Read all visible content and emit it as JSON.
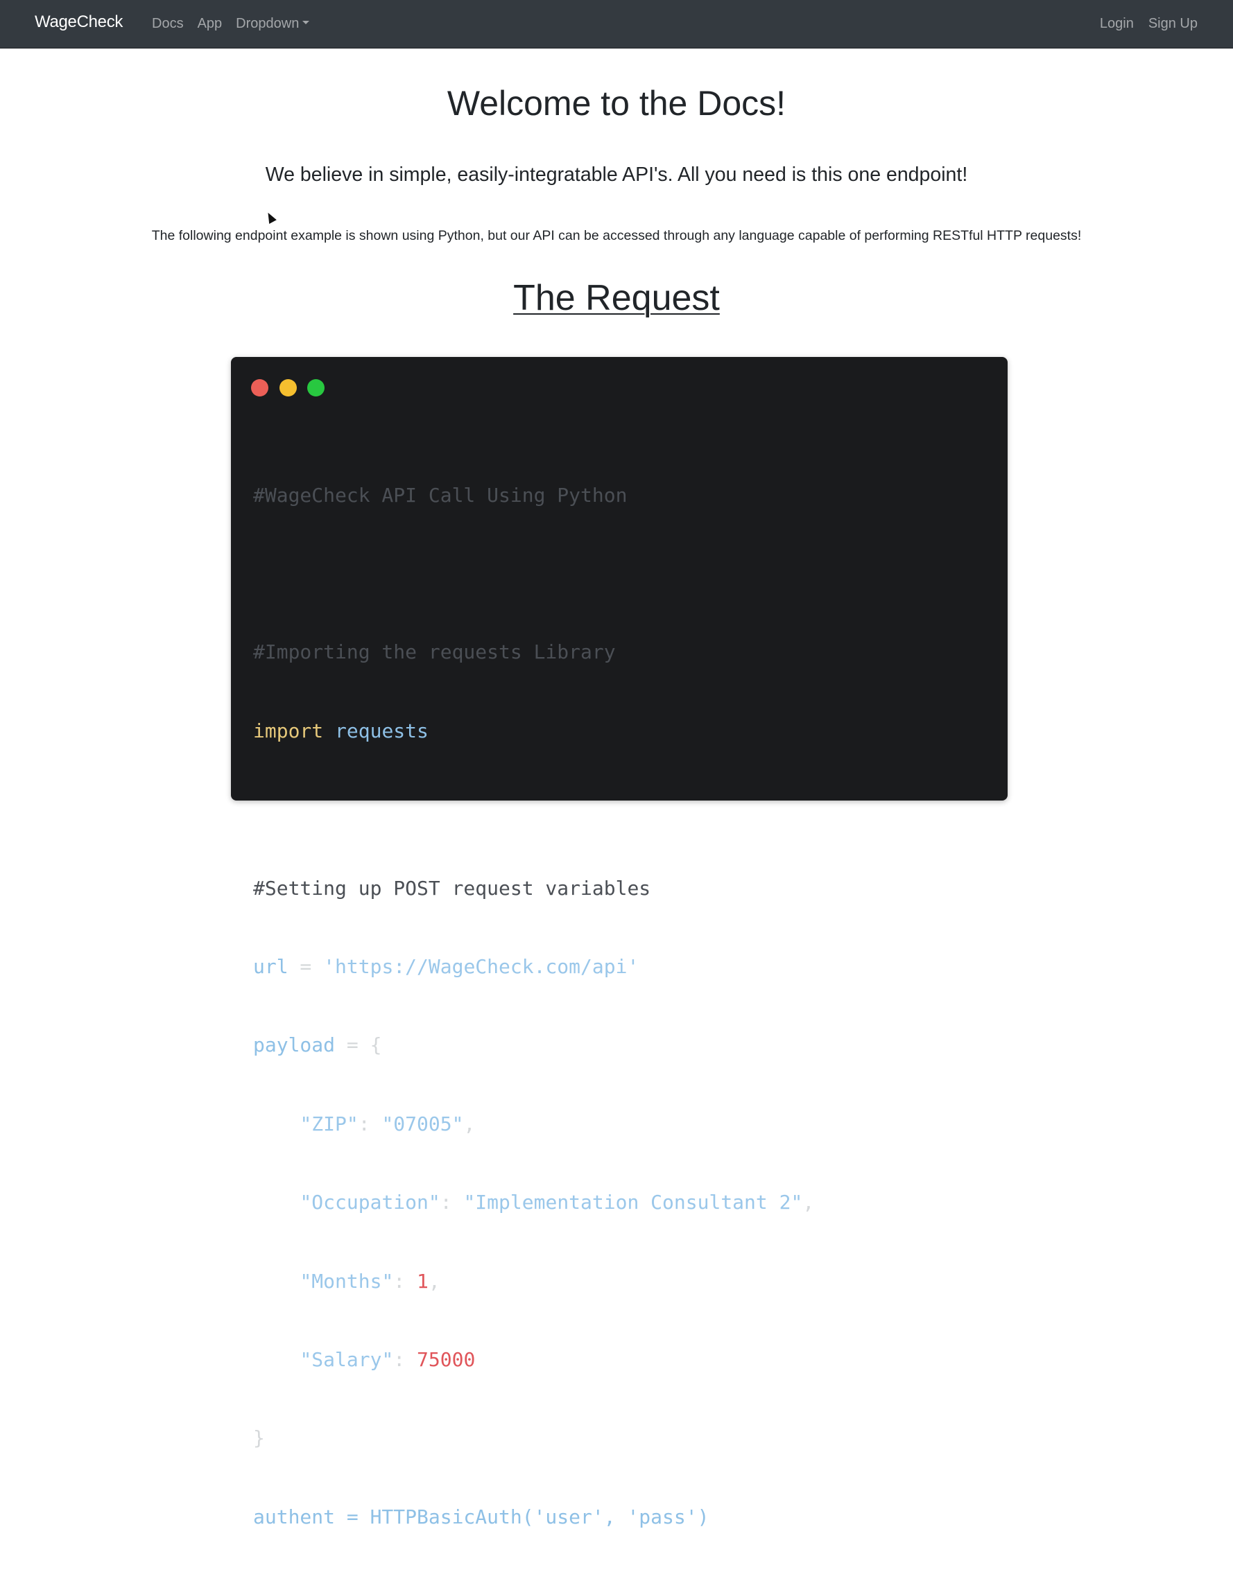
{
  "navbar": {
    "brand": "WageCheck",
    "links": [
      "Docs",
      "App",
      "Dropdown"
    ],
    "right_links": [
      "Login",
      "Sign Up"
    ]
  },
  "main": {
    "title": "Welcome to the Docs!",
    "lead": "We believe in simple, easily-integratable API's. All you need is this one endpoint!",
    "note": "The following endpoint example is shown using Python, but our API can be accessed through any language capable of performing RESTful HTTP requests!",
    "section_title": "The Request"
  },
  "code": {
    "comment_title": "#WageCheck API Call Using Python",
    "comment_import": "#Importing the requests Library",
    "kw_import": "import",
    "module": "requests",
    "comment_vars": "#Setting up POST request variables",
    "url_var": "url",
    "eq": " = ",
    "url_value": "'https://WageCheck.com/api'",
    "payload_var": "payload",
    "brace_open": "{",
    "zip_key": "\"ZIP\"",
    "zip_value": "\"07005\"",
    "occupation_key": "\"Occupation\"",
    "occupation_value": "\"Implementation Consultant 2\"",
    "months_key": "\"Months\"",
    "months_value": "1",
    "salary_key": "\"Salary\"",
    "salary_value": "75000",
    "brace_close": "}",
    "auth_line": "authent = HTTPBasicAuth('user', 'pass')"
  },
  "colors": {
    "navbar_bg": "#343a40",
    "code_bg": "#1a1b1d",
    "comment": "#4b4f55",
    "keyword": "#e6c87a",
    "identifier": "#8ec0e6",
    "number": "#e0555a"
  }
}
